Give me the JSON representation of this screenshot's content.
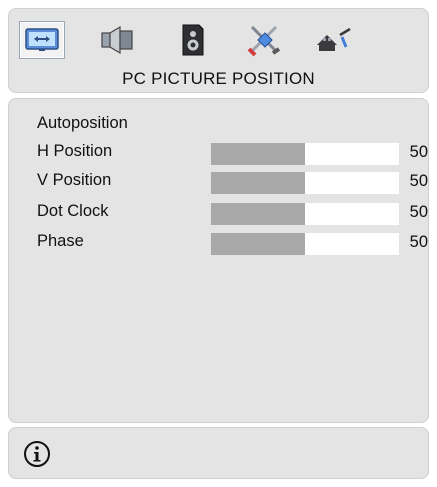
{
  "menu": {
    "title": "PC PICTURE POSITION",
    "tabs": [
      {
        "icon": "picture-icon",
        "selected": true
      },
      {
        "icon": "sound-icon",
        "selected": false
      },
      {
        "icon": "speaker-icon",
        "selected": false
      },
      {
        "icon": "tools-icon",
        "selected": false
      },
      {
        "icon": "install-icon",
        "selected": false
      }
    ]
  },
  "items": [
    {
      "label": "Autoposition"
    },
    {
      "label": "H Position",
      "value": "50",
      "level": 0.5
    },
    {
      "label": "V Position",
      "value": "50",
      "level": 0.5
    },
    {
      "label": "Dot Clock",
      "value": "50",
      "level": 0.5
    },
    {
      "label": "Phase",
      "value": "50",
      "level": 0.5
    }
  ],
  "footer": {
    "icon": "info-icon"
  },
  "colors": {
    "panel": "#e4e4e4",
    "bar_fill": "#a8a8a8",
    "bar_track": "#ffffff"
  }
}
